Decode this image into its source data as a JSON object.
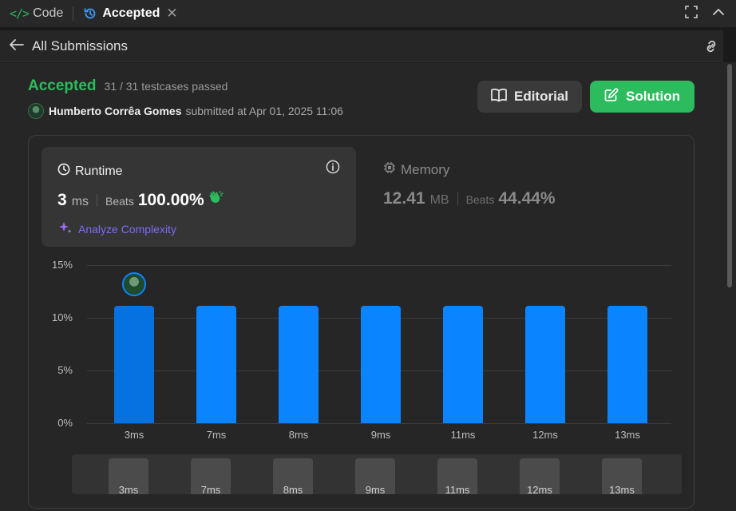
{
  "tabs": {
    "code_label": "Code",
    "accepted_label": "Accepted",
    "close_glyph": "✕"
  },
  "header": {
    "back_label": "All Submissions"
  },
  "submission": {
    "status": "Accepted",
    "testcases": "31 / 31 testcases passed",
    "author": "Humberto Corrêa Gomes",
    "submitted_text": "submitted at Apr 01, 2025 11:06"
  },
  "buttons": {
    "editorial": "Editorial",
    "solution": "Solution"
  },
  "runtime": {
    "title": "Runtime",
    "value": "3",
    "unit": "ms",
    "beats_label": "Beats",
    "beats_value": "100.00%",
    "analyze_label": "Analyze Complexity"
  },
  "memory": {
    "title": "Memory",
    "value": "12.41",
    "unit": "MB",
    "beats_label": "Beats",
    "beats_value": "44.44%"
  },
  "colors": {
    "accent_green": "#2cbb5d",
    "bar_blue": "#0a84ff",
    "analyze_purple": "#7b6cf6"
  },
  "chart_data": {
    "type": "bar",
    "categories": [
      "3ms",
      "7ms",
      "8ms",
      "9ms",
      "11ms",
      "12ms",
      "13ms"
    ],
    "values": [
      11.1,
      11.1,
      11.1,
      11.1,
      11.1,
      11.1,
      11.1
    ],
    "ylim": [
      0,
      15
    ],
    "yticks": [
      "0%",
      "5%",
      "10%",
      "15%"
    ],
    "ytick_values": [
      0,
      5,
      10,
      15
    ],
    "selected_index": 0,
    "grid": true
  }
}
